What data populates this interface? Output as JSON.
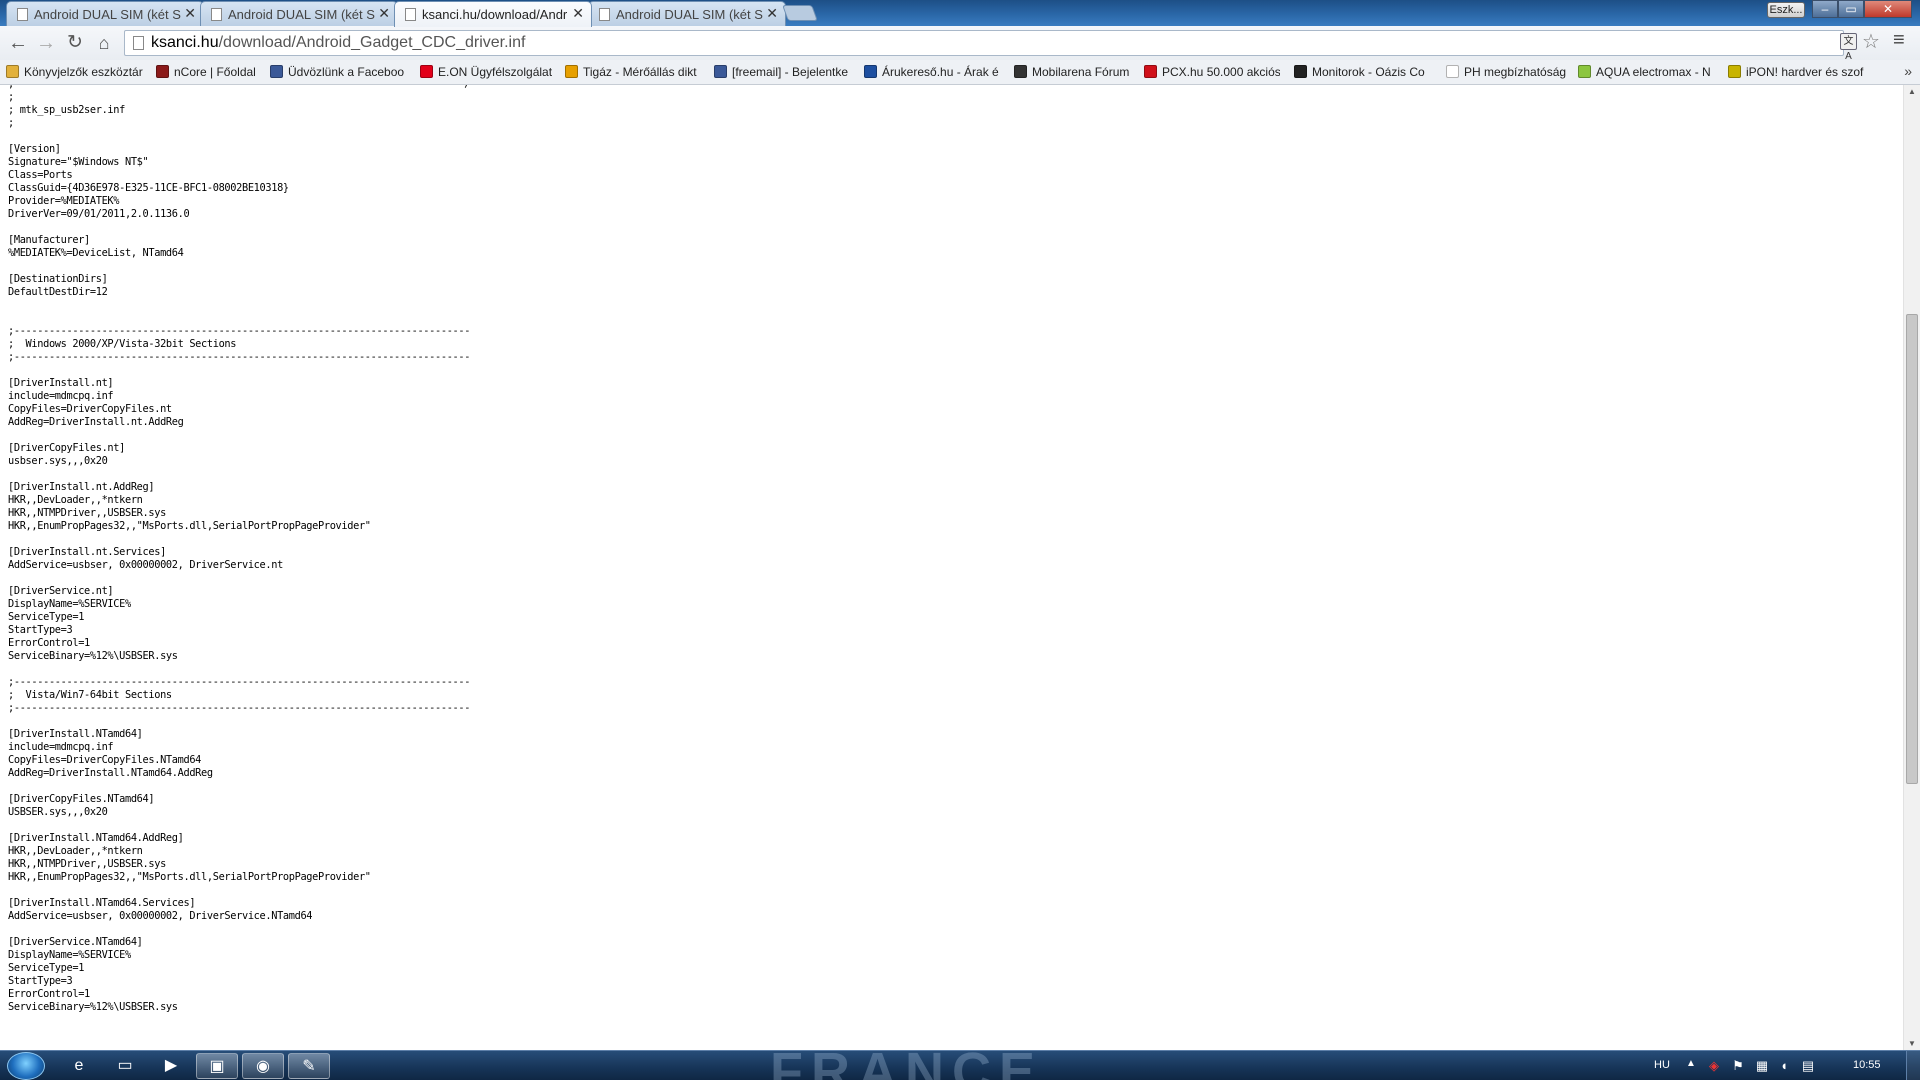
{
  "browser": {
    "tabs": [
      {
        "title": "Android DUAL SIM (két SI"
      },
      {
        "title": "Android DUAL SIM (két SI"
      },
      {
        "title": "ksanci.hu/download/Andr"
      },
      {
        "title": "Android DUAL SIM (két SI"
      }
    ],
    "user_badge": "Eszk...",
    "url_host": "ksanci.hu",
    "url_path": "/download/Android_Gadget_CDC_driver.inf",
    "bookmarks": [
      {
        "label": "Könyvjelzők eszköztár",
        "icon": "folder-icon",
        "color": "#e2b13c"
      },
      {
        "label": "nCore | Főoldal",
        "icon": "ncore-icon",
        "color": "#8b1a1a"
      },
      {
        "label": "Üdvözlünk a Faceboo",
        "icon": "facebook-icon",
        "color": "#3b5998"
      },
      {
        "label": "E.ON Ügyfélszolgálat",
        "icon": "eon-icon",
        "color": "#e2001a"
      },
      {
        "label": "Tigáz - Mérőállás dikt",
        "icon": "tigaz-icon",
        "color": "#e7a000"
      },
      {
        "label": "[freemail] - Bejelentke",
        "icon": "freemail-icon",
        "color": "#3b5998"
      },
      {
        "label": "Árukereső.hu - Árak é",
        "icon": "arukereso-icon",
        "color": "#1d4fa0"
      },
      {
        "label": "Mobilarena Fórum",
        "icon": "mobilarena-icon",
        "color": "#333333"
      },
      {
        "label": "PCX.hu 50.000 akciós",
        "icon": "pcx-icon",
        "color": "#d0101a"
      },
      {
        "label": "Monitorok - Oázis Co",
        "icon": "oazis-icon",
        "color": "#222222"
      },
      {
        "label": "PH megbízhatóság",
        "icon": "page-icon",
        "color": "#ffffff"
      },
      {
        "label": "AQUA electromax - N",
        "icon": "aqua-icon",
        "color": "#8cc63f"
      },
      {
        "label": "iPON! hardver és szof",
        "icon": "ipon-icon",
        "color": "#c8b400"
      }
    ]
  },
  "document": {
    "lines": [
      ";*****************************************************************************/",
      ";",
      "; mtk_sp_usb2ser.inf",
      ";",
      "",
      "[Version]",
      "Signature=\"$Windows NT$\"",
      "Class=Ports",
      "ClassGuid={4D36E978-E325-11CE-BFC1-08002BE10318}",
      "Provider=%MEDIATEK%",
      "DriverVer=09/01/2011,2.0.1136.0",
      "",
      "[Manufacturer]",
      "%MEDIATEK%=DeviceList, NTamd64",
      "",
      "[DestinationDirs]",
      "DefaultDestDir=12",
      "",
      "",
      ";------------------------------------------------------------------------------",
      ";  Windows 2000/XP/Vista-32bit Sections",
      ";------------------------------------------------------------------------------",
      "",
      "[DriverInstall.nt]",
      "include=mdmcpq.inf",
      "CopyFiles=DriverCopyFiles.nt",
      "AddReg=DriverInstall.nt.AddReg",
      "",
      "[DriverCopyFiles.nt]",
      "usbser.sys,,,0x20",
      "",
      "[DriverInstall.nt.AddReg]",
      "HKR,,DevLoader,,*ntkern",
      "HKR,,NTMPDriver,,USBSER.sys",
      "HKR,,EnumPropPages32,,\"MsPorts.dll,SerialPortPropPageProvider\"",
      "",
      "[DriverInstall.nt.Services]",
      "AddService=usbser, 0x00000002, DriverService.nt",
      "",
      "[DriverService.nt]",
      "DisplayName=%SERVICE%",
      "ServiceType=1",
      "StartType=3",
      "ErrorControl=1",
      "ServiceBinary=%12%\\USBSER.sys",
      "",
      ";------------------------------------------------------------------------------",
      ";  Vista/Win7-64bit Sections",
      ";------------------------------------------------------------------------------",
      "",
      "[DriverInstall.NTamd64]",
      "include=mdmcpq.inf",
      "CopyFiles=DriverCopyFiles.NTamd64",
      "AddReg=DriverInstall.NTamd64.AddReg",
      "",
      "[DriverCopyFiles.NTamd64]",
      "USBSER.sys,,,0x20",
      "",
      "[DriverInstall.NTamd64.AddReg]",
      "HKR,,DevLoader,,*ntkern",
      "HKR,,NTMPDriver,,USBSER.sys",
      "HKR,,EnumPropPages32,,\"MsPorts.dll,SerialPortPropPageProvider\"",
      "",
      "[DriverInstall.NTamd64.Services]",
      "AddService=usbser, 0x00000002, DriverService.NTamd64",
      "",
      "[DriverService.NTamd64]",
      "DisplayName=%SERVICE%",
      "ServiceType=1",
      "StartType=3",
      "ErrorControl=1",
      "ServiceBinary=%12%\\USBSER.sys"
    ]
  },
  "taskbar": {
    "language": "HU",
    "clock": "10:55",
    "apps": [
      {
        "name": "internet-explorer-icon",
        "glyph": "e"
      },
      {
        "name": "explorer-folder-icon",
        "glyph": "▭"
      },
      {
        "name": "media-player-icon",
        "glyph": "▶"
      },
      {
        "name": "save-disk-icon",
        "glyph": "▣"
      },
      {
        "name": "chrome-icon",
        "glyph": "◉"
      },
      {
        "name": "tool-app-icon",
        "glyph": "✎"
      }
    ]
  }
}
